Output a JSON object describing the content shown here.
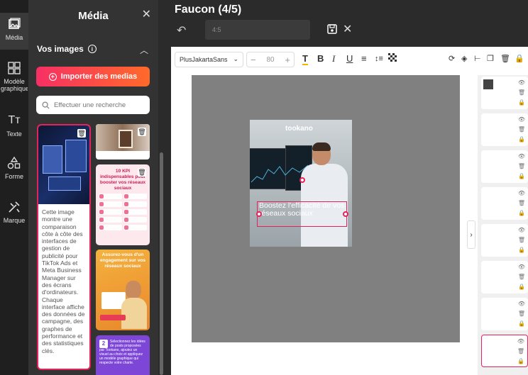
{
  "rail": [
    {
      "label": "Média",
      "icon": "image-icon"
    },
    {
      "label": "Modèle graphique",
      "icon": "grid-icon"
    },
    {
      "label": "Texte",
      "icon": "text-icon"
    },
    {
      "label": "Forme",
      "icon": "shapes-icon"
    },
    {
      "label": "Marque",
      "icon": "brand-icon"
    }
  ],
  "panel": {
    "title": "Média",
    "section_title": "Vos images",
    "import_label": "Importer des medias",
    "search_placeholder": "Effectuer une recherche",
    "selected_card_description": "Cette image montre une comparaison côte à côte des interfaces de gestion de publicité pour TikTok Ads et Meta Business Manager sur des écrans d'ordinateurs. Chaque interface affiche des données de campagne, des graphes de performance et des statistiques clés.",
    "card3_title": "10 KPI indispensables pour booster vos réseaux sociaux",
    "card4_title": "Assurez-vous d'un engagement sur vos réseaux sociaux",
    "card5_text": "Sélectionnez les idées de posts proposées par Tookano, ajoutez un visuel au choix et appliquez un modèle graphique qui respecte votre charte."
  },
  "header": {
    "title": "Faucon (4/5)",
    "name_value": "4:5"
  },
  "toolbar": {
    "font": "PlusJakartaSans",
    "font_size": "80"
  },
  "design": {
    "brand": "tookano",
    "headline": "Boostez l'efficacité de vos réseaux sociaux"
  },
  "colors": {
    "accent": "#e6225a",
    "gradient_start": "#f72f64",
    "gradient_end": "#ff6a2a"
  }
}
